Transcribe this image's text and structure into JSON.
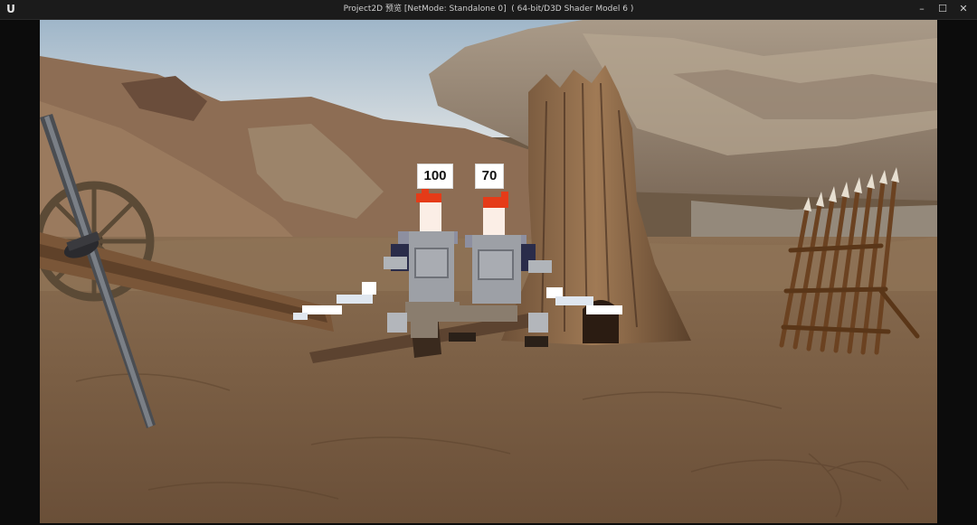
{
  "window": {
    "title": "Project2D 预览 [NetMode: Standalone 0]  ( 64-bit/D3D Shader Model 6 )",
    "logo_icon": "unreal-logo-icon",
    "buttons": {
      "minimize": "–",
      "maximize": "☐",
      "close": "✕"
    }
  },
  "game": {
    "characters": [
      {
        "hp": "100"
      },
      {
        "hp": "70"
      }
    ]
  }
}
